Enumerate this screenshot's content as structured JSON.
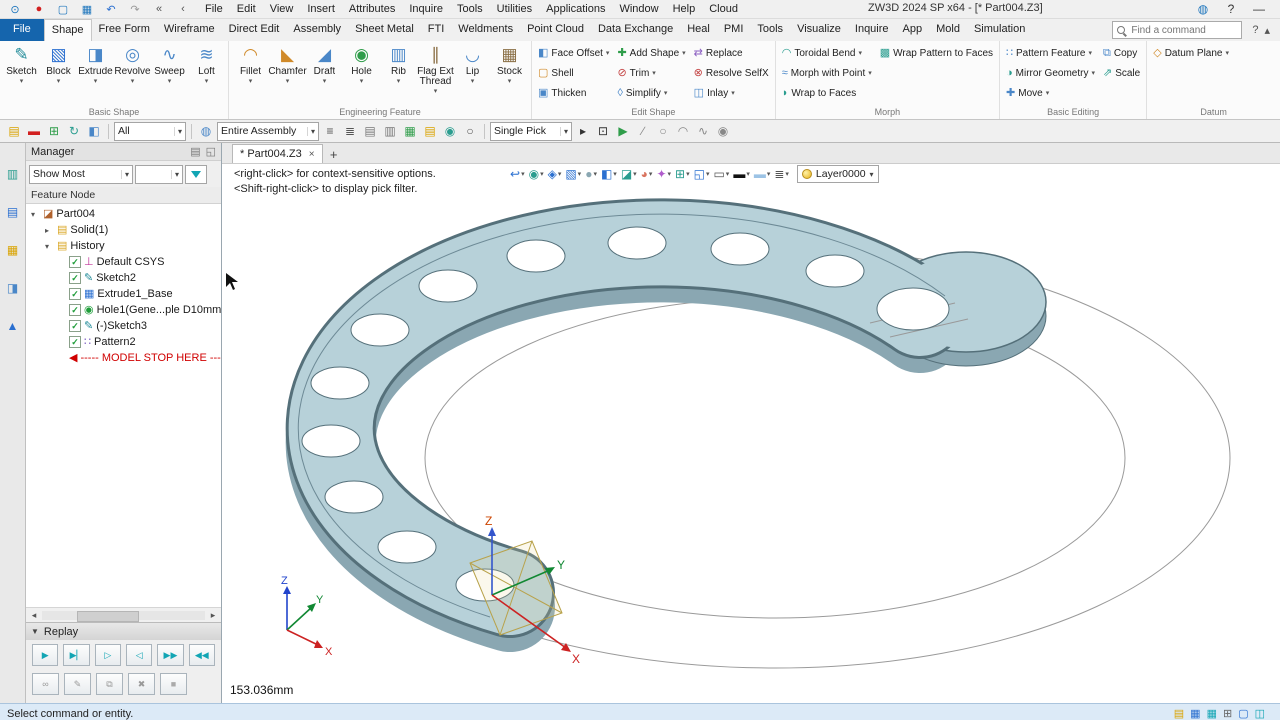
{
  "ui": {
    "dd": "▾",
    "check": "✓",
    "help": "?",
    "collapse": "▴"
  },
  "titlebar": {
    "title": "ZW3D 2024 SP x64 - [* Part004.Z3]",
    "qat": [
      {
        "n": "pin-icon",
        "g": "⊙",
        "c": "#1b74bc"
      },
      {
        "n": "record-icon",
        "g": "●",
        "c": "#d22020"
      },
      {
        "n": "new-file-icon",
        "g": "▢",
        "c": "#1b74bc"
      },
      {
        "n": "save-icon",
        "g": "▦",
        "c": "#1b74bc"
      },
      {
        "n": "undo-icon",
        "g": "↶",
        "c": "#2a6fd0"
      },
      {
        "n": "redo-icon",
        "g": "↷",
        "c": "#9a9a9a"
      },
      {
        "n": "collapse-left-icon",
        "g": "«",
        "c": "#555555"
      },
      {
        "n": "back-icon",
        "g": "‹",
        "c": "#555555"
      }
    ],
    "menus": [
      "File",
      "Edit",
      "View",
      "Insert",
      "Attributes",
      "Inquire",
      "Tools",
      "Utilities",
      "Applications",
      "Window",
      "Help",
      "Cloud"
    ],
    "window_controls": [
      {
        "n": "network-icon",
        "g": "◍",
        "c": "#1b74bc"
      },
      {
        "n": "help-icon",
        "g": "?",
        "c": "#333333"
      },
      {
        "n": "minimize-icon",
        "g": "—",
        "c": "#333333"
      }
    ]
  },
  "ribbon": {
    "search_placeholder": "Find a command",
    "tabs": [
      {
        "label": "File",
        "file": true
      },
      {
        "label": "Shape",
        "active": true
      },
      {
        "label": "Free Form"
      },
      {
        "label": "Wireframe"
      },
      {
        "label": "Direct Edit"
      },
      {
        "label": "Assembly"
      },
      {
        "label": "Sheet Metal"
      },
      {
        "label": "FTI"
      },
      {
        "label": "Weldments"
      },
      {
        "label": "Point Cloud"
      },
      {
        "label": "Data Exchange"
      },
      {
        "label": "Heal"
      },
      {
        "label": "PMI"
      },
      {
        "label": "Tools"
      },
      {
        "label": "Visualize"
      },
      {
        "label": "Inquire"
      },
      {
        "label": "App"
      },
      {
        "label": "Mold"
      },
      {
        "label": "Simulation"
      }
    ],
    "basic_shape": {
      "name": "Basic Shape",
      "buttons": [
        {
          "label": "Sketch",
          "g": "✎",
          "c": "#1f8a98"
        },
        {
          "label": "Block",
          "g": "▧",
          "c": "#2a6fd0"
        },
        {
          "label": "Extrude",
          "g": "◨",
          "c": "#4a87c8"
        },
        {
          "label": "Revolve",
          "g": "◎",
          "c": "#4a87c8"
        },
        {
          "label": "Sweep",
          "g": "∿",
          "c": "#4a87c8"
        },
        {
          "label": "Loft",
          "g": "≋",
          "c": "#4a87c8"
        }
      ]
    },
    "eng_feature": {
      "name": "Engineering Feature",
      "buttons": [
        {
          "label": "Fillet",
          "g": "◠",
          "c": "#d08a2a"
        },
        {
          "label": "Chamfer",
          "g": "◣",
          "c": "#d08a2a"
        },
        {
          "label": "Draft",
          "g": "◢",
          "c": "#4a87c8"
        },
        {
          "label": "Hole",
          "g": "◉",
          "c": "#2f9d4a"
        },
        {
          "label": "Rib",
          "g": "▥",
          "c": "#4a87c8"
        },
        {
          "label": "Flag Ext Thread",
          "g": "∥",
          "c": "#8a6f45"
        },
        {
          "label": "Lip",
          "g": "◡",
          "c": "#4a87c8"
        },
        {
          "label": "Stock",
          "g": "▦",
          "c": "#8a6f45"
        }
      ]
    },
    "edit_shape": {
      "name": "Edit Shape",
      "buttons": [
        {
          "label": "Face Offset",
          "g": "◧",
          "c": "#4a87c8",
          "dd": true
        },
        {
          "label": "Shell",
          "g": "▢",
          "c": "#d08a2a"
        },
        {
          "label": "Thicken",
          "g": "▣",
          "c": "#4a87c8"
        },
        {
          "label": "Add Shape",
          "g": "✚",
          "c": "#2f9d4a",
          "dd": true
        },
        {
          "label": "Trim",
          "g": "⊘",
          "c": "#c44444",
          "dd": true
        },
        {
          "label": "Simplify",
          "g": "◊",
          "c": "#4a87c8",
          "dd": true
        },
        {
          "label": "Replace",
          "g": "⇄",
          "c": "#8a5cc0"
        },
        {
          "label": "Resolve SelfX",
          "g": "⊗",
          "c": "#c44444"
        },
        {
          "label": "Inlay",
          "g": "◫",
          "c": "#4a87c8",
          "dd": true
        }
      ]
    },
    "morph": {
      "name": "Morph",
      "buttons": [
        {
          "label": "Toroidal Bend",
          "g": "◠",
          "c": "#2a9d8f",
          "dd": true
        },
        {
          "label": "Morph with Point",
          "g": "≈",
          "c": "#4a87c8",
          "dd": true
        },
        {
          "label": "Wrap to Faces",
          "g": "◗",
          "c": "#2a9d8f"
        },
        {
          "label": "Wrap Pattern to Faces",
          "g": "▩",
          "c": "#2a9d8f"
        }
      ]
    },
    "basic_editing": {
      "name": "Basic Editing",
      "buttons": [
        {
          "label": "Pattern Feature",
          "g": "∷",
          "c": "#4a87c8",
          "dd": true
        },
        {
          "label": "Mirror Geometry",
          "g": "◑",
          "c": "#2a9d8f",
          "dd": true
        },
        {
          "label": "Move",
          "g": "✚",
          "c": "#4a87c8",
          "dd": true
        },
        {
          "label": "Copy",
          "g": "⧉",
          "c": "#4a87c8"
        },
        {
          "label": "Scale",
          "g": "⇗",
          "c": "#2a9d8f"
        }
      ]
    },
    "datum": {
      "name": "Datum",
      "buttons": [
        {
          "label": "Datum Plane",
          "g": "◇",
          "c": "#d08a2a",
          "dd": true
        }
      ]
    }
  },
  "da": {
    "left": [
      {
        "n": "insert-table-icon",
        "g": "▤",
        "c": "#d9a300"
      },
      {
        "n": "erase-icon",
        "g": "▬",
        "c": "#d22020"
      },
      {
        "n": "add-grid-icon",
        "g": "⊞",
        "c": "#2f9d4a"
      },
      {
        "n": "regen-icon",
        "g": "↻",
        "c": "#2a9d8f"
      },
      {
        "n": "color-filter-icon",
        "g": "◧",
        "c": "#4a87c8"
      }
    ],
    "all_value": "All",
    "pre_assembly": [
      {
        "n": "display-filter-icon",
        "g": "◍",
        "c": "#4a87c8"
      }
    ],
    "assembly_value": "Entire Assembly",
    "mid": [
      {
        "n": "list-view-icon",
        "g": "≡",
        "c": "#555555"
      },
      {
        "n": "align-view-icon",
        "g": "≣",
        "c": "#555555"
      },
      {
        "n": "table-view-icon",
        "g": "▤",
        "c": "#777777"
      },
      {
        "n": "rows-view-icon",
        "g": "▥",
        "c": "#777777"
      },
      {
        "n": "green-table-icon",
        "g": "▦",
        "c": "#2f9d4a"
      },
      {
        "n": "yellow-sheet-icon",
        "g": "▤",
        "c": "#d9a300"
      },
      {
        "n": "snap-circle-icon",
        "g": "◉",
        "c": "#2a9d8f"
      },
      {
        "n": "ref-circle-icon",
        "g": "○",
        "c": "#555555"
      }
    ],
    "pick_value": "Single Pick",
    "right": [
      {
        "n": "pick-arrow-icon",
        "g": "▸",
        "c": "#333333"
      },
      {
        "n": "pick-box-icon",
        "g": "⊡",
        "c": "#333333"
      },
      {
        "n": "play-icon",
        "g": "▶",
        "c": "#2f9d4a"
      },
      {
        "n": "slash-tool-icon",
        "g": "∕",
        "c": "#888888"
      },
      {
        "n": "circle-tool-icon",
        "g": "○",
        "c": "#888888"
      },
      {
        "n": "arc-tool-icon",
        "g": "◠",
        "c": "#888888"
      },
      {
        "n": "spline-tool-icon",
        "g": "∿",
        "c": "#888888"
      },
      {
        "n": "visibility-icon",
        "g": "◉",
        "c": "#888888"
      }
    ]
  },
  "dock": {
    "items": [
      {
        "n": "manager-panel-icon",
        "g": "▥",
        "c": "#2a9d8f"
      },
      {
        "n": "assembly-panel-icon",
        "g": "▤",
        "c": "#2a6fd0"
      },
      {
        "n": "history-panel-icon",
        "g": "▦",
        "c": "#d9a300"
      },
      {
        "n": "visual-panel-icon",
        "g": "◨",
        "c": "#4a87c8"
      },
      {
        "n": "find-panel-icon",
        "g": "▲",
        "c": "#2a6fd0"
      }
    ]
  },
  "manager": {
    "title": "Manager",
    "header_icons": [
      {
        "n": "panel-list-icon",
        "g": "▤",
        "c": "#777777"
      },
      {
        "n": "panel-float-icon",
        "g": "◱",
        "c": "#777777"
      }
    ],
    "filter_value": "Show Most",
    "tree_header": "Feature Node",
    "items": [
      {
        "label": "Part004",
        "exp": "▾",
        "g": "◪",
        "c": "#b0622d"
      },
      {
        "label": "Solid(1)",
        "exp": "▸",
        "g": "▤",
        "c": "#d9a520",
        "lv1": true
      },
      {
        "label": "History",
        "exp": "▾",
        "g": "▤",
        "c": "#d9a520",
        "lv1": true
      },
      {
        "label": "Default CSYS",
        "checked": true,
        "g": "⊥",
        "c": "#c03399",
        "lv2": true
      },
      {
        "label": "Sketch2",
        "checked": true,
        "g": "✎",
        "c": "#1f8a98",
        "lv2": true
      },
      {
        "label": "Extrude1_Base",
        "checked": true,
        "g": "▦",
        "c": "#2a6fd0",
        "lv2": true
      },
      {
        "label": "Hole1(Gene...ple D10mm)",
        "checked": true,
        "g": "◉",
        "c": "#1f9d3a",
        "lv2": true
      },
      {
        "label": "(-)Sketch3",
        "checked": true,
        "g": "✎",
        "c": "#1f8a98",
        "lv2": true
      },
      {
        "label": "Pattern2",
        "checked": true,
        "g": "∷",
        "c": "#7a5cc0",
        "lv2": true
      },
      {
        "label": "----- MODEL STOP HERE -----",
        "stop": true,
        "g": "◀",
        "c": "#d00000",
        "lv2": true
      }
    ],
    "hscroll_left": "◂",
    "hscroll_right": "▸",
    "replay": {
      "collapse": "▼",
      "label": "Replay",
      "row1": [
        {
          "n": "replay-play-button",
          "g": "▶",
          "c": "#12a5b4"
        },
        {
          "n": "replay-step-button",
          "g": "▶▏",
          "c": "#12a5b4"
        },
        {
          "n": "replay-play-to-button",
          "g": "▷",
          "c": "#12a5b4"
        },
        {
          "n": "replay-back-button",
          "g": "◁",
          "c": "#12a5b4"
        },
        {
          "n": "replay-fast-forward-button",
          "g": "▶▶",
          "c": "#12a5b4"
        },
        {
          "n": "replay-rewind-button",
          "g": "◀◀",
          "c": "#12a5b4"
        }
      ],
      "row2": [
        {
          "n": "replay-link-button",
          "g": "∞",
          "c": "#999999"
        },
        {
          "n": "replay-edit-button",
          "g": "✎",
          "c": "#999999"
        },
        {
          "n": "replay-copy-button",
          "g": "⧉",
          "c": "#999999"
        },
        {
          "n": "replay-delete-button",
          "g": "✖",
          "c": "#999999"
        },
        {
          "n": "replay-swatch-button",
          "g": "■",
          "c": "#aaaaaa"
        }
      ]
    }
  },
  "canvas": {
    "doc_tab": "* Part004.Z3",
    "tab_close": "×",
    "tab_add": "+",
    "hint1": "<right-click> for context-sensitive options.",
    "hint2": "<Shift-right-click> to display pick filter.",
    "view_icons": [
      {
        "n": "view-back-icon",
        "g": "↩",
        "c": "#2a6fd0",
        "dd": true
      },
      {
        "n": "eye-icon",
        "g": "◉",
        "c": "#2a9d8f",
        "dd": true
      },
      {
        "n": "iso-view-icon",
        "g": "◈",
        "c": "#2a6fd0"
      },
      {
        "n": "view-orient-icon",
        "g": "▧",
        "c": "#2a6fd0",
        "dd": true
      },
      {
        "n": "shade-mode-icon",
        "g": "●",
        "c": "#8aa7b2",
        "dd": true
      },
      {
        "n": "display-cube-icon",
        "g": "◧",
        "c": "#2a6fd0",
        "dd": true
      },
      {
        "n": "section-view-icon",
        "g": "◪",
        "c": "#2a9d8f"
      },
      {
        "n": "appearance-icon",
        "g": "◕",
        "c": "#d9735e",
        "dd": true
      },
      {
        "n": "move-face-icon",
        "g": "✦",
        "c": "#b05ccc",
        "dd": true
      },
      {
        "n": "grid-display-icon",
        "g": "⊞",
        "c": "#2a9d8f",
        "dd": true
      },
      {
        "n": "window-display-icon",
        "g": "◱",
        "c": "#2a6fd0",
        "dd": true
      },
      {
        "n": "ruler-icon",
        "g": "▭",
        "c": "#555555",
        "dd": true
      },
      {
        "n": "black-swatch-icon",
        "g": "▬",
        "c": "#111111"
      },
      {
        "n": "blue-swatch-icon",
        "g": "▬",
        "c": "#9cc3e5"
      },
      {
        "n": "layer-list-icon",
        "g": "≣",
        "c": "#555555",
        "dd": true
      }
    ],
    "layer_label": "Layer0000",
    "measurement": "153.036mm",
    "axes": {
      "x": "X",
      "y": "Y",
      "z": "Z"
    }
  },
  "statusbar": {
    "message": "Select command or entity.",
    "icons": [
      {
        "n": "sheet-status-icon",
        "g": "▤",
        "c": "#d9a300"
      },
      {
        "n": "table-status-icon",
        "g": "▦",
        "c": "#2a6fd0"
      },
      {
        "n": "view-status-icon",
        "g": "▦",
        "c": "#12a5b4"
      },
      {
        "n": "grid-status-icon",
        "g": "⊞",
        "c": "#666666"
      },
      {
        "n": "box-status-icon",
        "g": "▢",
        "c": "#2a6fd0"
      },
      {
        "n": "panel-status-icon",
        "g": "◫",
        "c": "#12a5b4"
      }
    ]
  }
}
